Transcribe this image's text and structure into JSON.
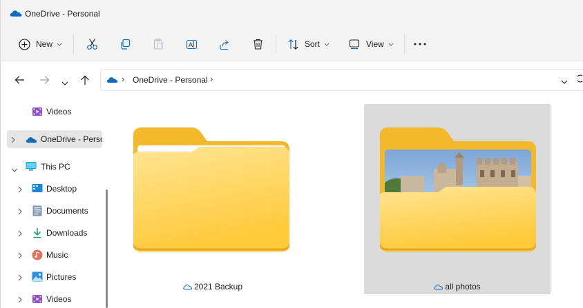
{
  "window": {
    "title": "OneDrive - Personal"
  },
  "toolbar": {
    "new_label": "New",
    "sort_label": "Sort",
    "view_label": "View"
  },
  "address": {
    "path": "OneDrive - Personal"
  },
  "sidebar": {
    "items": [
      {
        "label": "Videos"
      },
      {
        "label": "OneDrive - Personal"
      },
      {
        "label": "This PC"
      },
      {
        "label": "Desktop"
      },
      {
        "label": "Documents"
      },
      {
        "label": "Downloads"
      },
      {
        "label": "Music"
      },
      {
        "label": "Pictures"
      },
      {
        "label": "Videos"
      }
    ]
  },
  "content": {
    "items": [
      {
        "name": "2021 Backup"
      },
      {
        "name": "all photos"
      }
    ]
  },
  "colors": {
    "folder_back": "#f3b92a",
    "folder_front": "#ffd76a",
    "onedrive_blue": "#0f6cbd",
    "selection": "#dadada"
  }
}
